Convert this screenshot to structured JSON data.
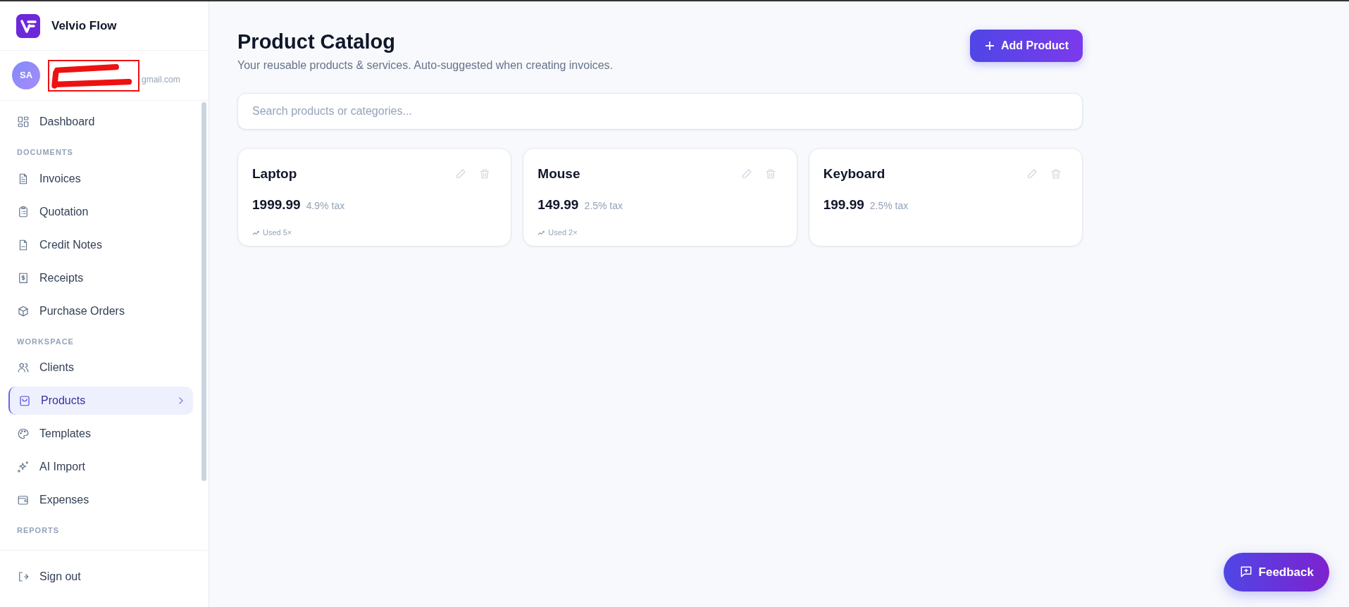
{
  "brand": {
    "name": "Velvio Flow"
  },
  "user": {
    "initials": "SA",
    "email": "gmail.com"
  },
  "nav": [
    {
      "kind": "item",
      "label": "Dashboard",
      "selected": false
    },
    {
      "kind": "section",
      "label": "DOCUMENTS"
    },
    {
      "kind": "item",
      "label": "Invoices",
      "selected": false
    },
    {
      "kind": "item",
      "label": "Quotation",
      "selected": false
    },
    {
      "kind": "item",
      "label": "Credit Notes",
      "selected": false
    },
    {
      "kind": "item",
      "label": "Receipts",
      "selected": false
    },
    {
      "kind": "item",
      "label": "Purchase Orders",
      "selected": false
    },
    {
      "kind": "section",
      "label": "WORKSPACE"
    },
    {
      "kind": "item",
      "label": "Clients",
      "selected": false
    },
    {
      "kind": "item",
      "label": "Products",
      "selected": true
    },
    {
      "kind": "item",
      "label": "Templates",
      "selected": false
    },
    {
      "kind": "item",
      "label": "AI Import",
      "selected": false
    },
    {
      "kind": "item",
      "label": "Expenses",
      "selected": false
    },
    {
      "kind": "section",
      "label": "REPORTS"
    }
  ],
  "sign_out": "Sign out",
  "page": {
    "title": "Product Catalog",
    "subtitle": "Your reusable products & services. Auto-suggested when creating invoices.",
    "add_button": "Add Product"
  },
  "search": {
    "placeholder": "Search products or categories..."
  },
  "products": [
    {
      "name": "Laptop",
      "price": "1999.99",
      "tax": "4.9% tax",
      "usage": "Used 5×"
    },
    {
      "name": "Mouse",
      "price": "149.99",
      "tax": "2.5% tax",
      "usage": "Used 2×"
    },
    {
      "name": "Keyboard",
      "price": "199.99",
      "tax": "2.5% tax"
    }
  ],
  "feedback_button": "Feedback"
}
